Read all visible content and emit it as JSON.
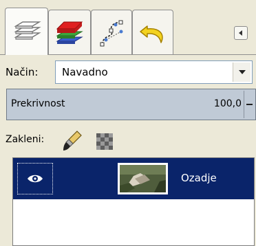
{
  "tabs": [
    {
      "name": "layers-tab",
      "icon": "layers-icon",
      "active": true
    },
    {
      "name": "channels-tab",
      "icon": "channels-icon",
      "active": false
    },
    {
      "name": "paths-tab",
      "icon": "paths-icon",
      "active": false
    },
    {
      "name": "undo-history-tab",
      "icon": "undo-icon",
      "active": false
    }
  ],
  "tab_menu": {
    "icon": "tab-menu-arrow-icon"
  },
  "mode": {
    "label": "Način:",
    "value": "Navadno"
  },
  "opacity": {
    "label": "Prekrivnost",
    "value": "100,0"
  },
  "lock": {
    "label": "Zakleni:",
    "brush_icon": "paintbrush-icon",
    "alpha_icon": "alpha-lock-icon"
  },
  "layers": [
    {
      "name": "Ozadje",
      "visible": true,
      "selected": true
    }
  ],
  "colors": {
    "selection": "#0a246a",
    "panel": "#ece9d8",
    "opacity_bar": "#c0cad6"
  }
}
